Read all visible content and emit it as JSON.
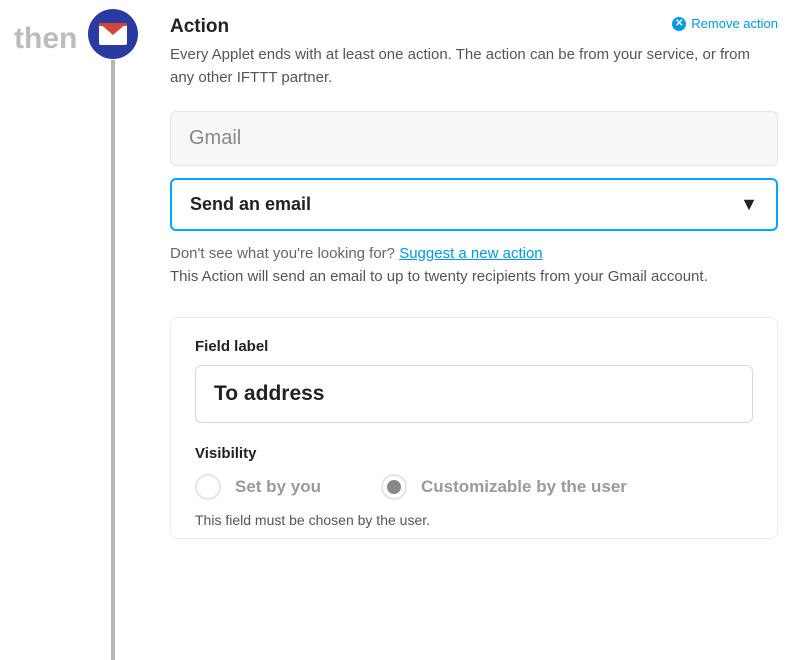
{
  "left": {
    "then_label": "then",
    "service_icon": "gmail-icon"
  },
  "header": {
    "title": "Action",
    "remove_label": "Remove action",
    "description": "Every Applet ends with at least one action. The action can be from your service, or from any other IFTTT partner."
  },
  "action": {
    "service_value": "Gmail",
    "selected_action": "Send an email",
    "suggest_prefix": "Don't see what you're looking for?  ",
    "suggest_link": "Suggest a new action",
    "action_description": "This Action will send an email to up to twenty recipients from your Gmail account."
  },
  "field": {
    "label_heading": "Field label",
    "label_value": "To address",
    "visibility_heading": "Visibility",
    "options": {
      "set_by_you": "Set by you",
      "customizable": "Customizable by the user"
    },
    "selected_option": "customizable",
    "note": "This field must be chosen by the user."
  }
}
